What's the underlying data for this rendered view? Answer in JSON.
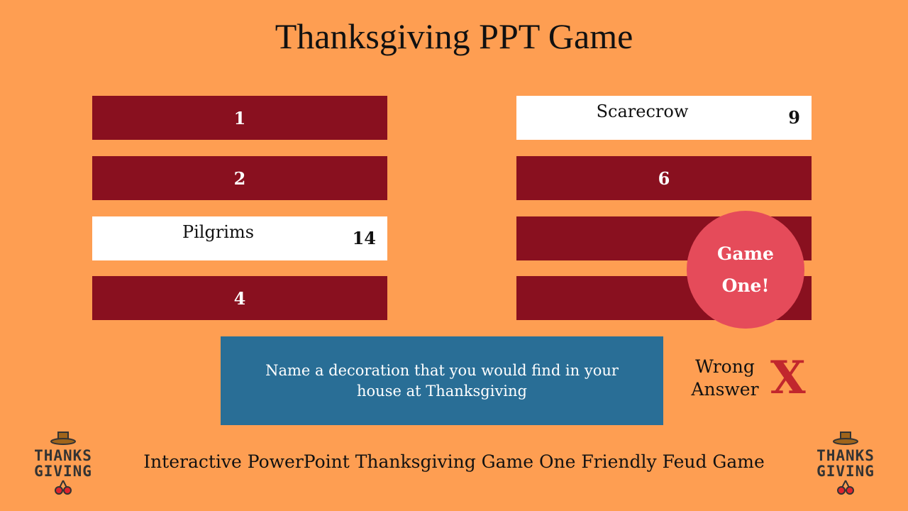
{
  "title": "Thanksgiving PPT Game",
  "left_slots": [
    {
      "label": "1"
    },
    {
      "label": "2"
    },
    {
      "answer": "Pilgrims",
      "points": "14"
    },
    {
      "label": "4"
    }
  ],
  "right_slots": [
    {
      "answer": "Scarecrow",
      "points": "9"
    },
    {
      "label": "6"
    },
    {
      "label": ""
    },
    {
      "label": ""
    }
  ],
  "badge": {
    "line1": "Game",
    "line2": "One!"
  },
  "question": "Name a decoration that you would find in your house at Thanksgiving",
  "wrong": {
    "line1": "Wrong",
    "line2": "Answer",
    "mark": "X"
  },
  "footer": "Interactive PowerPoint Thanksgiving Game One Friendly Feud Game",
  "logo": {
    "line1": "THANKS",
    "line2": "GIVING"
  },
  "colors": {
    "background": "#FE9E52",
    "slot": "#89101F",
    "question": "#296E96",
    "badge": "#E54B5A",
    "x": "#C1272D"
  }
}
